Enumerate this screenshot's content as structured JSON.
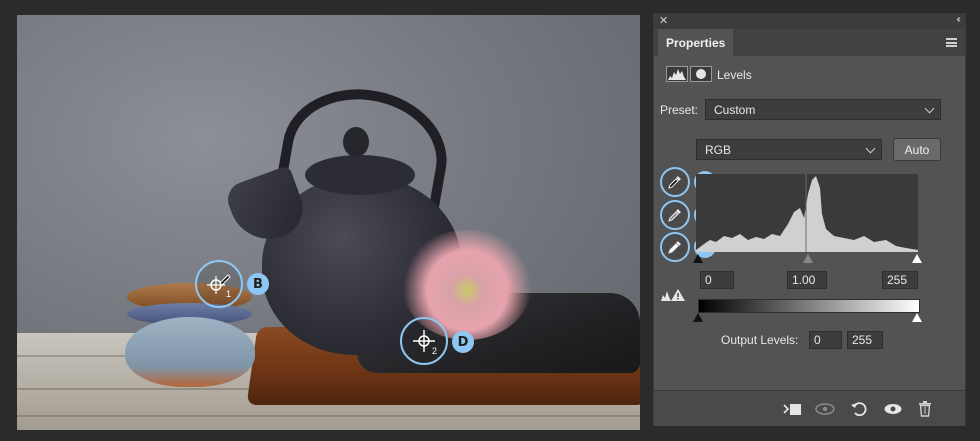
{
  "canvas": {
    "markers": [
      {
        "id": "B",
        "label": "B",
        "sub": "1"
      },
      {
        "id": "D",
        "label": "D",
        "sub": "2"
      }
    ]
  },
  "panel": {
    "tab_label": "Properties",
    "adjustment_label": "Levels",
    "preset_label": "Preset:",
    "preset_value": "Custom",
    "channel_value": "RGB",
    "auto_label": "Auto",
    "droppers": [
      {
        "badge": "A",
        "icon": "black-point-eyedropper-icon"
      },
      {
        "badge": "E",
        "icon": "gray-point-eyedropper-icon"
      },
      {
        "badge": "C",
        "icon": "white-point-eyedropper-icon"
      }
    ],
    "input_black": "0",
    "input_gamma": "1.00",
    "input_white": "255",
    "output_label": "Output Levels:",
    "output_black": "0",
    "output_white": "255",
    "bottom_icons": [
      "clip-to-layer-icon",
      "view-previous-icon",
      "reset-icon",
      "visibility-eye-icon",
      "delete-trash-icon"
    ]
  },
  "colors": {
    "accent": "#8ec6f3",
    "panel_bg": "#535353",
    "app_bg": "#2b2b2b"
  }
}
